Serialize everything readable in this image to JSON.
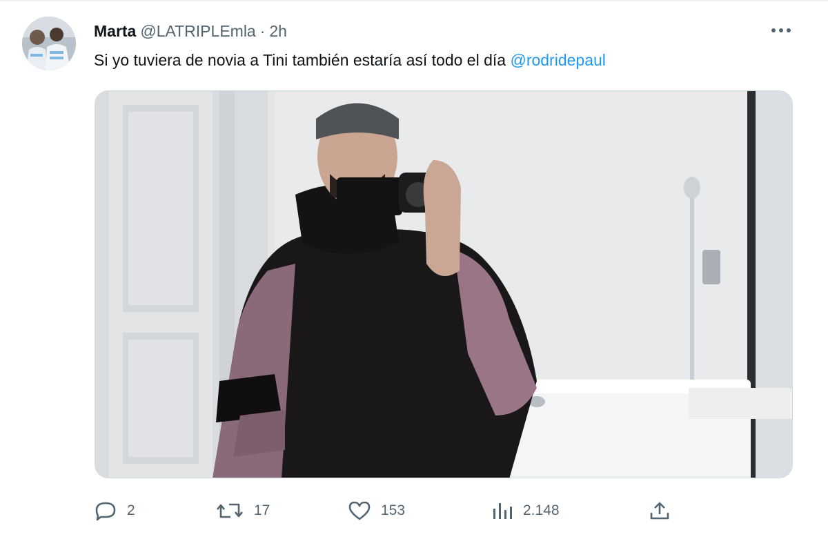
{
  "tweet": {
    "author_name": "Marta",
    "handle": "@LATRIPLEmla",
    "separator": "·",
    "time": "2h",
    "text_before": "Si yo tuviera de novia a Tini también estaría así todo el día ",
    "mention": "@rodridepaul"
  },
  "actions": {
    "replies": "2",
    "retweets": "17",
    "likes": "153",
    "views": "2.148"
  },
  "icons": {
    "more": "more-horizontal-icon",
    "reply": "reply-icon",
    "retweet": "retweet-icon",
    "like": "heart-icon",
    "views": "views-chart-icon",
    "share": "share-icon"
  },
  "colors": {
    "link": "#1d9bf0",
    "secondary_text": "#536471"
  }
}
